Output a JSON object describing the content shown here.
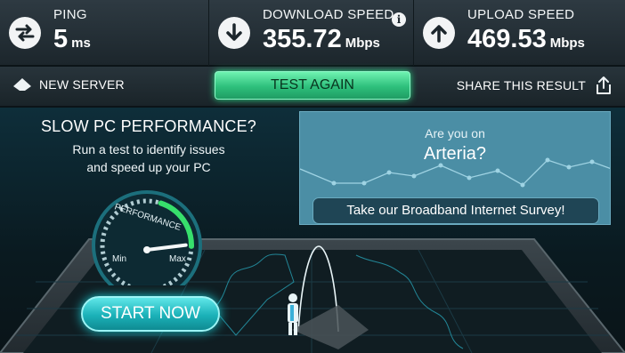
{
  "stats": {
    "ping": {
      "label": "PING",
      "value": "5",
      "unit": "ms",
      "icon": "ping-arrows-icon"
    },
    "download": {
      "label": "DOWNLOAD SPEED",
      "value": "355.72",
      "unit": "Mbps",
      "icon": "download-arrow-icon"
    },
    "upload": {
      "label": "UPLOAD SPEED",
      "value": "469.53",
      "unit": "Mbps",
      "icon": "upload-arrow-icon"
    },
    "info_glyph": "i"
  },
  "actions": {
    "new_server": "NEW SERVER",
    "test_again": "TEST AGAIN",
    "share": "SHARE THIS RESULT"
  },
  "promo": {
    "title": "SLOW PC PERFORMANCE?",
    "subtitle_line1": "Run a test to identify issues",
    "subtitle_line2": "and speed up your PC",
    "gauge_label": "PERFORMANCE",
    "gauge_min": "Min",
    "gauge_max": "Max",
    "gauge_level": 0.85,
    "start_button": "START NOW"
  },
  "ad": {
    "question": "Are you on",
    "isp": "Arteria?",
    "survey_button": "Take our Broadband Internet Survey!"
  },
  "colors": {
    "accent_green": "#2ec07c",
    "accent_cyan": "#1bb1b8",
    "ad_blue": "#4b8ea5"
  }
}
